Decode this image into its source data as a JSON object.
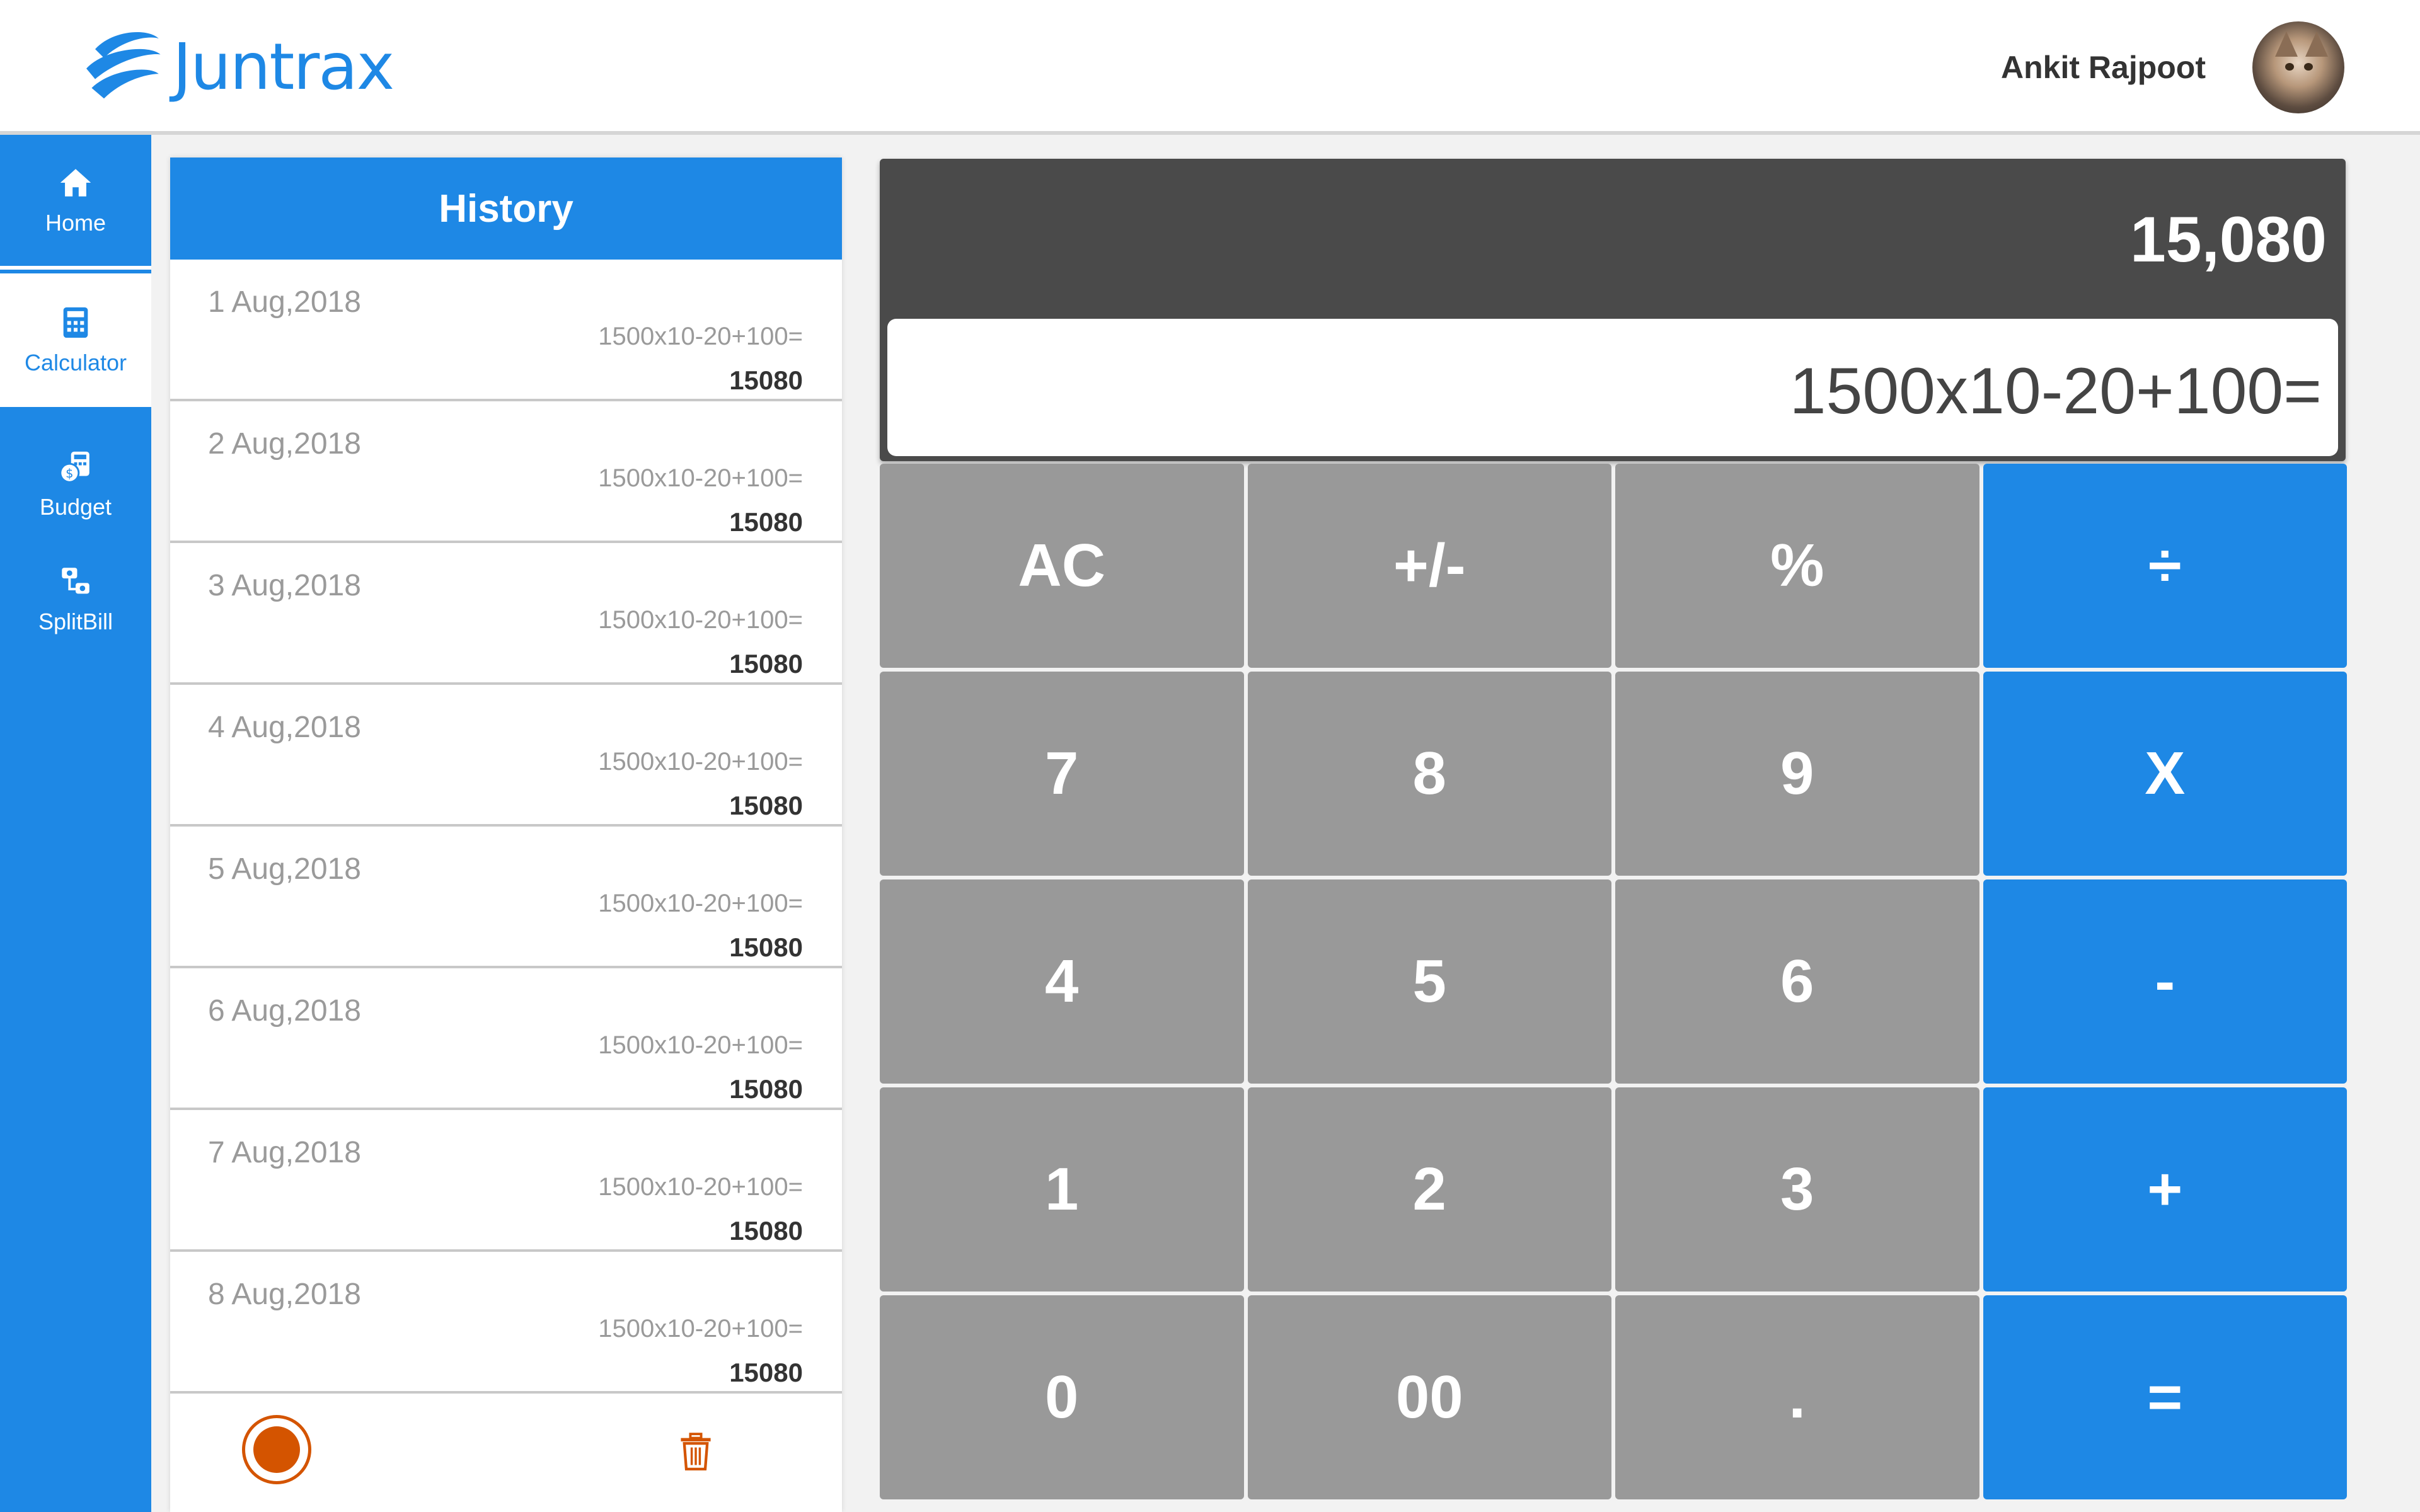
{
  "app": {
    "brand": "Juntrax"
  },
  "user": {
    "name": "Ankit Rajpoot"
  },
  "sidebar": {
    "items": [
      {
        "label": "Home",
        "icon": "home-icon"
      },
      {
        "label": "Calculator",
        "icon": "calculator-icon",
        "active": true
      },
      {
        "label": "Budget",
        "icon": "budget-icon"
      },
      {
        "label": "SplitBill",
        "icon": "split-bill-icon"
      }
    ]
  },
  "history": {
    "title": "History",
    "items": [
      {
        "date": "1 Aug,2018",
        "expression": "1500x10-20+100=",
        "result": "15080"
      },
      {
        "date": "2 Aug,2018",
        "expression": "1500x10-20+100=",
        "result": "15080"
      },
      {
        "date": "3 Aug,2018",
        "expression": "1500x10-20+100=",
        "result": "15080"
      },
      {
        "date": "4 Aug,2018",
        "expression": "1500x10-20+100=",
        "result": "15080"
      },
      {
        "date": "5 Aug,2018",
        "expression": "1500x10-20+100=",
        "result": "15080"
      },
      {
        "date": "6 Aug,2018",
        "expression": "1500x10-20+100=",
        "result": "15080"
      },
      {
        "date": "7 Aug,2018",
        "expression": "1500x10-20+100=",
        "result": "15080"
      },
      {
        "date": "8 Aug,2018",
        "expression": "1500x10-20+100=",
        "result": "15080"
      }
    ]
  },
  "calculator": {
    "result": "15,080",
    "expression": "1500x10-20+100=",
    "keys": [
      {
        "label": "AC",
        "name": "clear"
      },
      {
        "label": "+/-",
        "name": "sign"
      },
      {
        "label": "%",
        "name": "percent"
      },
      {
        "label": "÷",
        "name": "divide"
      },
      {
        "label": "7",
        "name": "7"
      },
      {
        "label": "8",
        "name": "8"
      },
      {
        "label": "9",
        "name": "9"
      },
      {
        "label": "X",
        "name": "multiply"
      },
      {
        "label": "4",
        "name": "4"
      },
      {
        "label": "5",
        "name": "5"
      },
      {
        "label": "6",
        "name": "6"
      },
      {
        "label": "-",
        "name": "subtract"
      },
      {
        "label": "1",
        "name": "1"
      },
      {
        "label": "2",
        "name": "2"
      },
      {
        "label": "3",
        "name": "3"
      },
      {
        "label": "+",
        "name": "add"
      },
      {
        "label": "0",
        "name": "0"
      },
      {
        "label": "00",
        "name": "double-zero"
      },
      {
        "label": ".",
        "name": "decimal"
      },
      {
        "label": "=",
        "name": "equals"
      }
    ]
  },
  "colors": {
    "primary": "#1e88e5",
    "key_gray": "#999999",
    "display_dark": "#4a4a4a",
    "record_orange": "#d45400"
  }
}
